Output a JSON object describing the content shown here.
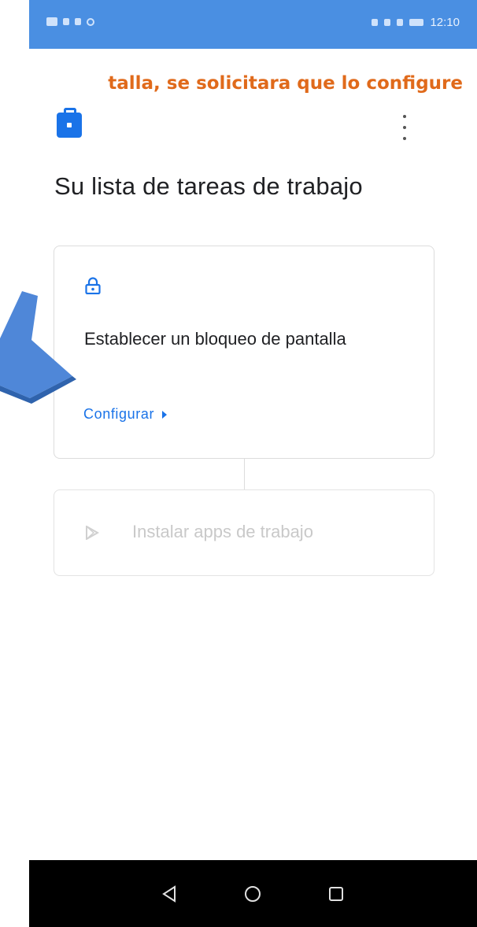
{
  "statusbar": {
    "time": "12:10"
  },
  "annotation": {
    "text": "talla, se solicitara que lo configure"
  },
  "header": {
    "work_icon": "briefcase-icon",
    "menu_icon": "more-vert-icon"
  },
  "page": {
    "title": "Su lista de tareas de trabajo"
  },
  "tasks": [
    {
      "icon": "lock-icon",
      "label": "Establecer un bloqueo de pantalla",
      "action_label": "Configurar",
      "enabled": true
    },
    {
      "icon": "play-store-icon",
      "label": "Instalar apps de trabajo",
      "enabled": false
    }
  ],
  "navbar": {
    "back_icon": "back-triangle-icon",
    "home_icon": "home-circle-icon",
    "recents_icon": "recents-square-icon"
  },
  "colors": {
    "accent": "#1a73e8",
    "statusbar": "#4a8fe2",
    "annotation": "#e06a1b",
    "arrow": "#4f87d8"
  }
}
